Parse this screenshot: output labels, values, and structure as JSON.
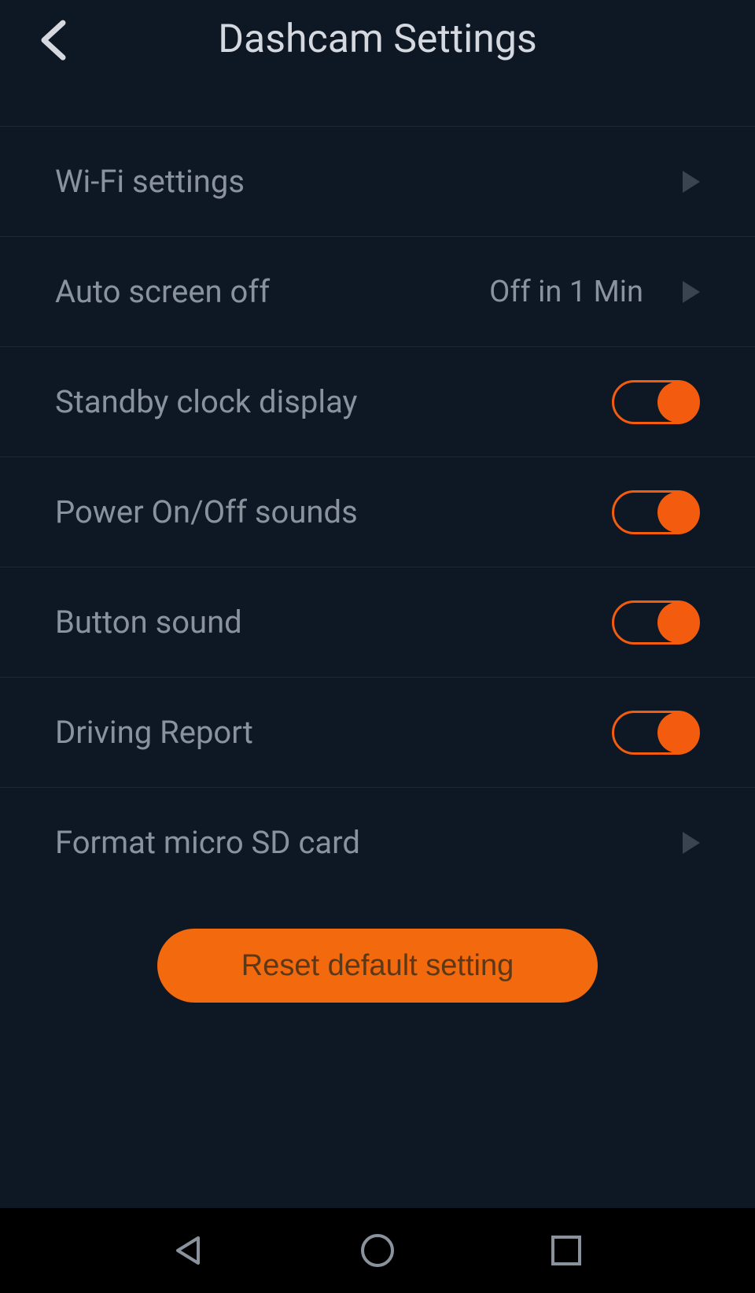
{
  "header": {
    "title": "Dashcam Settings"
  },
  "settings": {
    "wifi": {
      "label": "Wi-Fi settings"
    },
    "autoScreenOff": {
      "label": "Auto screen off",
      "value": "Off in 1 Min"
    },
    "standbyClock": {
      "label": "Standby clock display",
      "enabled": true
    },
    "powerSounds": {
      "label": "Power On/Off sounds",
      "enabled": true
    },
    "buttonSound": {
      "label": "Button sound",
      "enabled": true
    },
    "drivingReport": {
      "label": "Driving Report",
      "enabled": true
    },
    "formatSd": {
      "label": "Format micro SD card"
    }
  },
  "actions": {
    "reset": "Reset default setting"
  }
}
